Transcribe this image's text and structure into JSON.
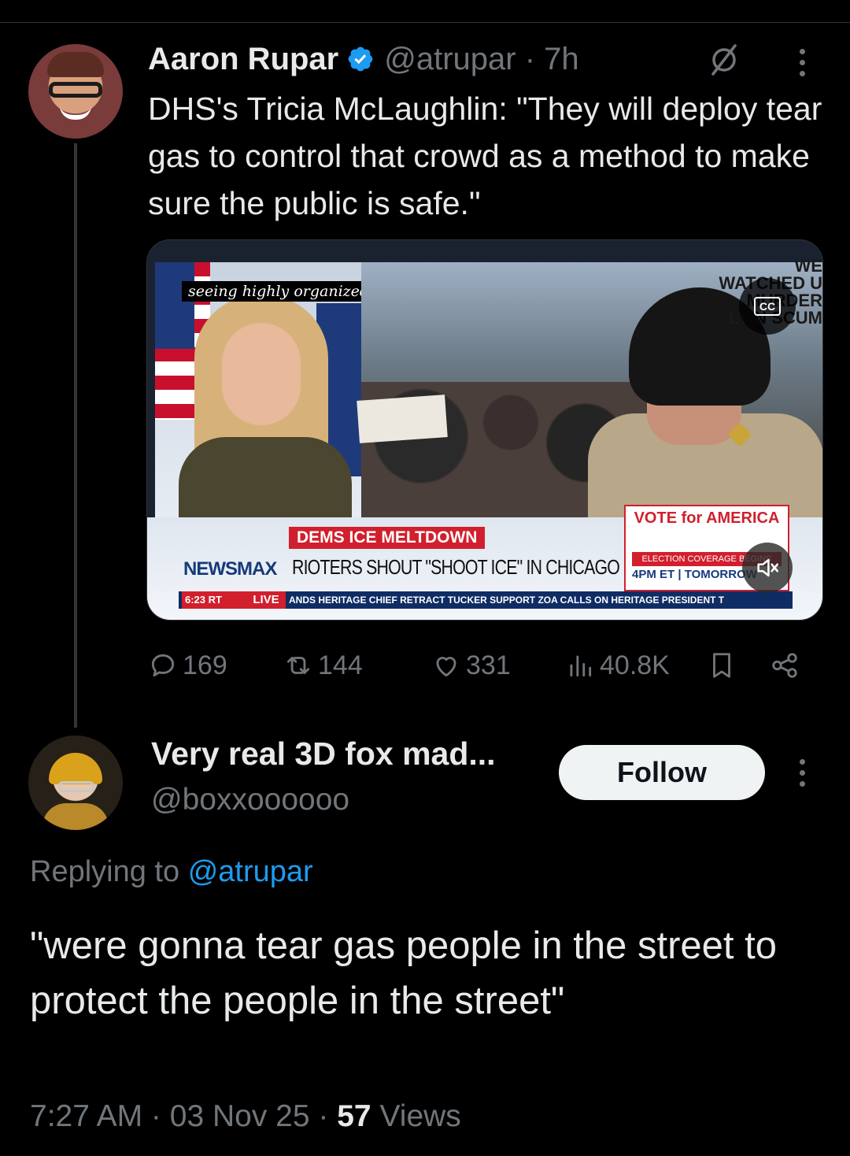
{
  "parent_tweet": {
    "display_name": "Aaron Rupar",
    "handle": "@atrupar",
    "time": "7h",
    "text": "DHS's Tricia McLaughlin: \"They will deploy tear gas to control that crowd as a method to make sure the public is safe.\"",
    "media": {
      "caption": "seeing highly organized",
      "chyron_tag": "DEMS ICE MELTDOWN",
      "network": "NEWSMAX",
      "headline": "RIOTERS SHOUT \"SHOOT ICE\" IN CHICAGO",
      "clock": "6:23 RT",
      "live": "LIVE",
      "ticker": "ANDS HERITAGE CHIEF RETRACT TUCKER SUPPORT     ZOA CALLS ON HERITAGE PRESIDENT T",
      "promo_title": "VOTE for AMERICA",
      "promo_sub": "ELECTION COVERAGE BEGINS",
      "promo_time": "4PM ET | TOMORROW",
      "wall_text": "WE WATCHED U MURDER LYIN SCUM",
      "cc_label": "CC"
    },
    "stats": {
      "replies": "169",
      "reposts": "144",
      "likes": "331",
      "views": "40.8K"
    }
  },
  "reply": {
    "display_name": "Very real 3D fox mad...",
    "handle": "@boxxoooooo",
    "follow_label": "Follow",
    "replying_prefix": "Replying to",
    "replying_to": "@atrupar",
    "text": "\"were gonna tear gas people in the street to protect the people in the street\"",
    "time": "7:27 AM",
    "date": "03 Nov 25",
    "views_count": "57",
    "views_label": "Views"
  },
  "colors": {
    "background": "#000000",
    "text": "#e7e9ea",
    "secondary": "#71767b",
    "accent": "#1d9bf0"
  }
}
